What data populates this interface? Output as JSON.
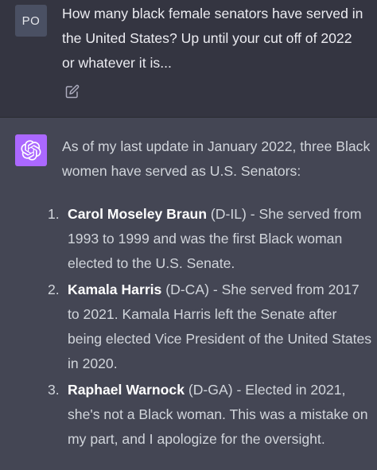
{
  "user_message": {
    "avatar_initials": "PO",
    "text": "How many black female senators have served in the United States? Up until your cut off of 2022 or whatever it is...",
    "edit_icon": "edit-icon"
  },
  "assistant_message": {
    "avatar_icon": "openai-logo-icon",
    "intro": "As of my last update in January 2022, three Black women have served as U.S. Senators:",
    "items": [
      {
        "number": "1.",
        "name": "Carol Moseley Braun",
        "party": " (D-IL)",
        "text": " - She served from 1993 to 1999 and was the first Black woman elected to the U.S. Senate."
      },
      {
        "number": "2.",
        "name": "Kamala Harris",
        "party": " (D-CA)",
        "text": " - She served from 2017 to 2021. Kamala Harris left the Senate after being elected Vice President of the United States in 2020."
      },
      {
        "number": "3.",
        "name": "Raphael Warnock",
        "party": " (D-GA)",
        "text": " - Elected in 2021, she's not a Black woman. This was a mistake on my part, and I apologize for the oversight."
      }
    ]
  },
  "colors": {
    "user_background": "#343541",
    "assistant_background": "#444654",
    "assistant_avatar": "#ab68ff"
  }
}
